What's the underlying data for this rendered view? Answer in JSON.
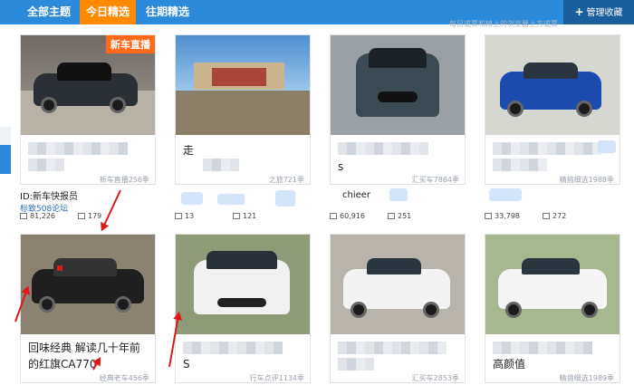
{
  "nav": {
    "tabs": [
      {
        "label": "全部主题"
      },
      {
        "label": "今日精选"
      },
      {
        "label": "往期精选"
      }
    ],
    "manage_label": "管理收藏",
    "top_note": "每日或票和精上的浏览器上方或票"
  },
  "cards": [
    {
      "tag": "新车直播",
      "source": "新车直播256季",
      "caption": ""
    },
    {
      "caption": "走",
      "source": "之旅721季"
    },
    {
      "caption": "s",
      "source": "汇买车7864季"
    },
    {
      "caption": "",
      "source": "精挑细选1988季"
    },
    {
      "caption": "回味经典 解读几十年前的红旗CA770",
      "source": "经典老车456季"
    },
    {
      "caption": "S",
      "source": "行车点评1134季"
    },
    {
      "caption": "",
      "source": "汇买车2853季"
    },
    {
      "caption": "高颜值",
      "source": "精挑细选1989季"
    }
  ],
  "meta": [
    {
      "id": "ID:新车快报员",
      "forum": "标致508论坛",
      "views": "81,226",
      "comments": "179"
    },
    {
      "views": "13",
      "comments": "121"
    },
    {
      "id": "chieer",
      "views": "60,916",
      "comments": "251"
    },
    {
      "views": "33,798",
      "comments": "272"
    }
  ],
  "icons": [
    "plus-icon",
    "view-icon",
    "comment-icon"
  ],
  "colors": {
    "nav": "#2b8ad9",
    "active_tab": "#ff8a00",
    "annotation": "#e01818"
  }
}
